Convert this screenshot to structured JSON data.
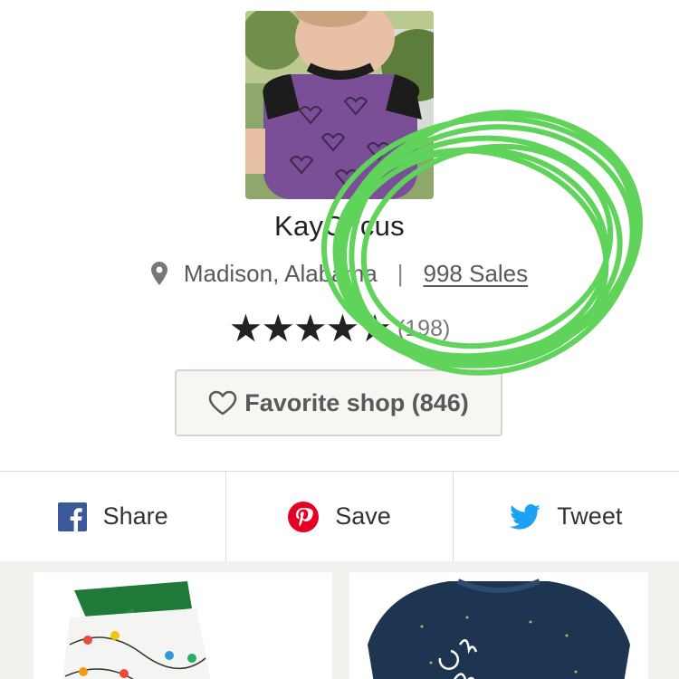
{
  "shop": {
    "name": "KayCircus",
    "location": "Madison, Alabama",
    "separator": "|",
    "sales": "998 Sales",
    "stars": "★★★★★",
    "rating": 5,
    "review_count": "(198)"
  },
  "favorite_button": {
    "label": "Favorite shop (846)"
  },
  "share": [
    {
      "label": "Share",
      "icon": "facebook-icon",
      "color": "#3b5998"
    },
    {
      "label": "Save",
      "icon": "pinterest-icon",
      "color": "#e60023"
    },
    {
      "label": "Tweet",
      "icon": "twitter-icon",
      "color": "#1da1f2"
    }
  ],
  "annotation": {
    "color": "#5fd35a"
  }
}
